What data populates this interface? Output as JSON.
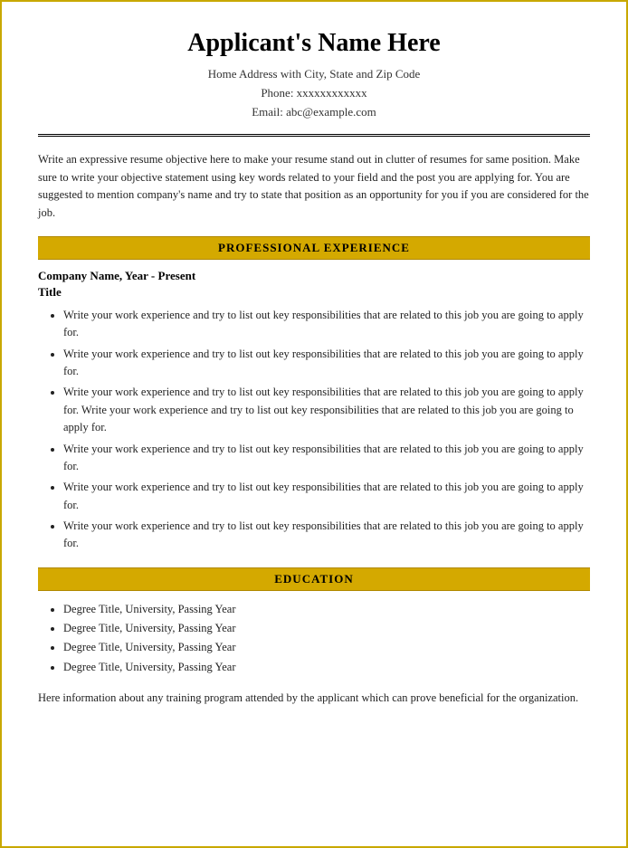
{
  "resume": {
    "name": "Applicant's Name Here",
    "contact": {
      "address": "Home Address with City, State and Zip Code",
      "phone": "Phone: xxxxxxxxxxxx",
      "email": "Email: abc@example.com"
    },
    "objective": "Write an expressive resume objective here to make your resume stand out in clutter of resumes for same position. Make sure to write your objective statement using key words related to your field and the post you are applying for. You are suggested to mention company's name and try to state that position as an opportunity for you if you are considered for the job.",
    "sections": {
      "professional_experience": {
        "header": "PROFESSIONAL EXPERIENCE",
        "company_line": "Company Name, Year - Present",
        "title_line": "Title",
        "items": [
          "Write your work experience and try to list out key responsibilities that are related to this job you are going to apply for.",
          "Write your work experience and try to list out key responsibilities that are related to this job you are going to apply for.",
          "Write your work experience and try to list out key responsibilities that are related to this job you are going to apply for. Write your work experience and try to list out key responsibilities that are related to this job you are going to apply for.",
          "Write your work experience and try to list out key responsibilities that are related to this job you are going to apply for.",
          "Write your work experience and try to list out key responsibilities that are related to this job you are going to apply for.",
          "Write your work experience and try to list out key responsibilities that are related to this job you are going to apply for."
        ]
      },
      "education": {
        "header": "EDUCATION",
        "items": [
          "Degree Title, University, Passing Year",
          "Degree Title, University, Passing Year",
          "Degree Title, University, Passing Year",
          "Degree Title, University, Passing Year"
        ],
        "training_text": "Here information about any training program attended by the applicant which can prove beneficial for the organization."
      }
    }
  }
}
